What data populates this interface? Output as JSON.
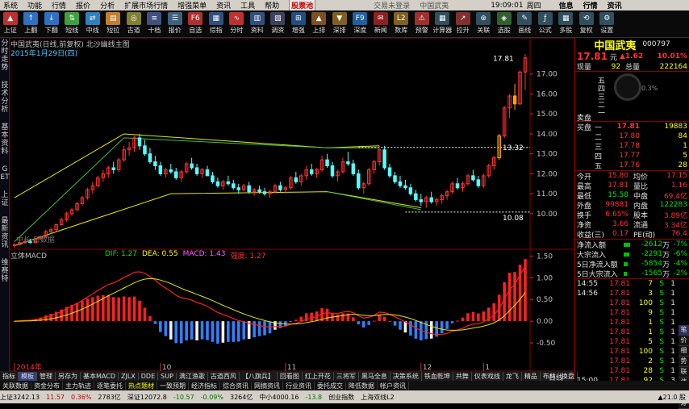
{
  "menu": {
    "items": [
      "系统",
      "功能",
      "行情",
      "报价",
      "分析",
      "扩展市场行情",
      "增强菜单",
      "资讯",
      "工具",
      "帮助"
    ],
    "promo": "股票池",
    "center_title": "交易未登录",
    "center_title2": "中国武夷",
    "clock": "19:09:01",
    "weekday": "周四",
    "right_items": [
      "信息",
      "行情",
      "资讯"
    ]
  },
  "toolbar": [
    {
      "label": "上证",
      "color": "#c03030",
      "glyph": "▲"
    },
    {
      "label": "上翻",
      "color": "#3070c0",
      "glyph": "↑"
    },
    {
      "label": "下翻",
      "color": "#3070c0",
      "glyph": "↓"
    },
    {
      "label": "短线",
      "color": "#40a040",
      "glyph": "⇅"
    },
    {
      "label": "中线",
      "color": "#3080c0",
      "glyph": "⇄"
    },
    {
      "label": "短拉",
      "color": "#c08030",
      "glyph": "▤"
    },
    {
      "label": "古道",
      "color": "#808030",
      "glyph": "◎"
    },
    {
      "label": "十档",
      "color": "#405080",
      "glyph": "≡"
    },
    {
      "label": "报价",
      "color": "#406080",
      "glyph": "☰"
    },
    {
      "label": "自选",
      "color": "#b03030",
      "glyph": "F6"
    },
    {
      "label": "综指",
      "color": "#305080",
      "glyph": "▦"
    },
    {
      "label": "分时",
      "color": "#c03030",
      "glyph": "∿"
    },
    {
      "label": "资料",
      "color": "#305080",
      "glyph": "▥"
    },
    {
      "label": "调资",
      "color": "#404060",
      "glyph": "▧"
    },
    {
      "label": "增强",
      "color": "#205080",
      "glyph": "⊞"
    },
    {
      "label": "上排",
      "color": "#805020",
      "glyph": "▲"
    },
    {
      "label": "深排",
      "color": "#806020",
      "glyph": "▼"
    },
    {
      "label": "深度",
      "color": "#2060a0",
      "glyph": "F9"
    },
    {
      "label": "新闻",
      "color": "#902020",
      "glyph": "✉"
    },
    {
      "label": "数库",
      "color": "#806020",
      "glyph": "L2"
    },
    {
      "label": "预警",
      "color": "#a03030",
      "glyph": "⚠"
    },
    {
      "label": "计算器",
      "color": "#305060",
      "glyph": "▦"
    },
    {
      "label": "拉升",
      "color": "#803030",
      "glyph": "↗"
    },
    {
      "label": "关联",
      "color": "#305060",
      "glyph": "⊛"
    },
    {
      "label": "选股",
      "color": "#306030",
      "glyph": "◈"
    },
    {
      "label": "画线",
      "color": "#305060",
      "glyph": "✎"
    },
    {
      "label": "公式",
      "color": "#305060",
      "glyph": "ƒ"
    },
    {
      "label": "多股",
      "color": "#305060",
      "glyph": "▦"
    },
    {
      "label": "复权",
      "color": "#305060",
      "glyph": "⟲"
    },
    {
      "label": "设置",
      "color": "#305060",
      "glyph": "⚙"
    }
  ],
  "sidebar": [
    "分时走势",
    "技术分析",
    "基本资料",
    "GET",
    "上证",
    "最新资讯",
    "维赛特"
  ],
  "chart": {
    "title": "中国武夷(日线,前复权) 北沙幽线主图",
    "date_label": "2015年1月29日(四)",
    "price_hi_label": "17.81",
    "ref_label_1": "13.32",
    "ref_label_2": "10.08",
    "watermark": "中长·日数据",
    "macd_title": "立体MACD",
    "macd_params": [
      "DIF: 1.27",
      "DEA: 0.55",
      "MACD: 1.43",
      "强度: 1.27"
    ],
    "x_labels": [
      "2014年",
      "10",
      "11",
      "12",
      "1"
    ],
    "period": "日线"
  },
  "chart_data": [
    {
      "type": "candlestick",
      "title": "中国武夷(日线,前复权) 北沙幽线主图",
      "ylim": [
        8.5,
        18.0
      ],
      "yticks": [
        10,
        11,
        12,
        13,
        14,
        15,
        16,
        17
      ],
      "ohlc": [
        [
          8.4,
          8.5,
          8.3,
          8.45
        ],
        [
          8.45,
          8.6,
          8.4,
          8.55
        ],
        [
          8.55,
          8.7,
          8.5,
          8.6
        ],
        [
          8.6,
          8.75,
          8.5,
          8.55
        ],
        [
          8.55,
          8.8,
          8.5,
          8.75
        ],
        [
          8.75,
          8.9,
          8.7,
          8.85
        ],
        [
          8.85,
          9.2,
          8.8,
          9.1
        ],
        [
          9.1,
          9.3,
          9.0,
          9.2
        ],
        [
          9.2,
          9.5,
          9.1,
          9.45
        ],
        [
          9.45,
          9.8,
          9.4,
          9.7
        ],
        [
          9.7,
          10.1,
          9.6,
          10.0
        ],
        [
          10.0,
          10.3,
          9.9,
          10.2
        ],
        [
          10.2,
          10.6,
          10.1,
          10.5
        ],
        [
          10.5,
          10.9,
          10.4,
          10.8
        ],
        [
          10.8,
          11.3,
          10.7,
          11.2
        ],
        [
          11.2,
          11.6,
          11.0,
          11.4
        ],
        [
          11.4,
          11.9,
          11.3,
          11.8
        ],
        [
          11.8,
          12.2,
          11.6,
          12.0
        ],
        [
          12.0,
          12.4,
          11.8,
          12.3
        ],
        [
          12.3,
          12.6,
          12.0,
          12.2
        ],
        [
          12.2,
          12.8,
          12.1,
          12.7
        ],
        [
          12.7,
          13.4,
          12.6,
          13.2
        ],
        [
          13.2,
          13.6,
          12.9,
          13.3
        ],
        [
          13.3,
          13.9,
          13.1,
          13.8
        ],
        [
          13.8,
          14.0,
          13.2,
          13.4
        ],
        [
          13.4,
          13.7,
          12.9,
          13.0
        ],
        [
          13.0,
          13.3,
          12.5,
          12.6
        ],
        [
          12.6,
          12.9,
          12.2,
          12.4
        ],
        [
          12.4,
          12.6,
          11.9,
          12.0
        ],
        [
          12.0,
          12.3,
          11.8,
          12.2
        ],
        [
          12.2,
          12.5,
          12.0,
          12.1
        ],
        [
          12.1,
          12.3,
          11.7,
          11.8
        ],
        [
          11.8,
          12.2,
          11.6,
          12.1
        ],
        [
          12.1,
          12.6,
          12.0,
          12.5
        ],
        [
          12.5,
          12.8,
          12.2,
          12.3
        ],
        [
          12.3,
          12.5,
          11.9,
          12.0
        ],
        [
          12.0,
          12.3,
          11.8,
          12.2
        ],
        [
          12.2,
          12.4,
          11.9,
          11.9
        ],
        [
          11.9,
          12.1,
          11.5,
          11.6
        ],
        [
          11.6,
          11.8,
          11.3,
          11.4
        ],
        [
          11.4,
          11.7,
          11.2,
          11.6
        ],
        [
          11.6,
          11.9,
          11.4,
          11.5
        ],
        [
          11.5,
          11.7,
          11.2,
          11.3
        ],
        [
          11.3,
          11.5,
          11.0,
          11.2
        ],
        [
          11.2,
          11.5,
          11.1,
          11.4
        ],
        [
          11.4,
          11.6,
          11.0,
          11.1
        ],
        [
          11.1,
          11.3,
          10.9,
          11.2
        ],
        [
          11.2,
          11.4,
          11.0,
          11.1
        ],
        [
          11.1,
          11.3,
          10.9,
          11.0
        ],
        [
          11.0,
          11.2,
          10.8,
          11.1
        ],
        [
          11.1,
          11.5,
          11.0,
          11.4
        ],
        [
          11.4,
          11.6,
          11.1,
          11.2
        ],
        [
          11.2,
          11.4,
          11.0,
          11.3
        ],
        [
          11.3,
          11.9,
          11.2,
          11.8
        ],
        [
          11.8,
          12.1,
          11.5,
          11.6
        ],
        [
          11.6,
          12.0,
          11.4,
          11.9
        ],
        [
          11.9,
          12.4,
          11.7,
          12.2
        ],
        [
          12.2,
          12.5,
          11.9,
          12.0
        ],
        [
          12.0,
          12.3,
          11.8,
          12.2
        ],
        [
          12.2,
          12.9,
          12.1,
          12.7
        ],
        [
          12.7,
          13.0,
          12.3,
          12.4
        ],
        [
          12.4,
          12.6,
          11.8,
          11.9
        ],
        [
          11.9,
          12.2,
          11.6,
          12.1
        ],
        [
          12.1,
          12.8,
          12.0,
          12.6
        ],
        [
          12.6,
          13.1,
          12.4,
          12.5
        ],
        [
          12.5,
          12.7,
          11.9,
          12.0
        ],
        [
          12.0,
          12.2,
          11.2,
          11.3
        ],
        [
          11.3,
          11.6,
          11.0,
          11.5
        ],
        [
          11.5,
          12.3,
          11.4,
          12.2
        ],
        [
          12.2,
          12.7,
          12.0,
          12.6
        ],
        [
          12.6,
          13.4,
          12.4,
          13.2
        ],
        [
          13.2,
          13.4,
          12.2,
          12.3
        ],
        [
          12.3,
          12.5,
          11.8,
          11.9
        ],
        [
          11.9,
          12.1,
          11.5,
          11.6
        ],
        [
          11.6,
          11.9,
          11.3,
          11.4
        ],
        [
          11.4,
          11.7,
          11.2,
          11.3
        ],
        [
          11.3,
          11.5,
          10.9,
          11.0
        ],
        [
          11.0,
          11.2,
          10.6,
          10.7
        ],
        [
          10.7,
          11.0,
          10.4,
          10.6
        ],
        [
          10.6,
          10.9,
          10.3,
          10.8
        ],
        [
          10.8,
          11.1,
          10.5,
          10.6
        ],
        [
          10.6,
          10.8,
          10.4,
          10.7
        ],
        [
          10.7,
          11.0,
          10.5,
          10.9
        ],
        [
          10.9,
          11.2,
          10.7,
          11.1
        ],
        [
          11.1,
          11.6,
          11.0,
          11.5
        ],
        [
          11.5,
          11.8,
          11.2,
          11.3
        ],
        [
          11.3,
          11.6,
          11.1,
          11.5
        ],
        [
          11.5,
          12.0,
          11.4,
          11.9
        ],
        [
          11.9,
          12.2,
          11.6,
          11.7
        ],
        [
          11.7,
          11.9,
          11.3,
          11.4
        ],
        [
          11.4,
          12.0,
          11.3,
          11.9
        ],
        [
          11.9,
          12.5,
          11.8,
          12.4
        ],
        [
          12.4,
          12.9,
          12.2,
          12.8
        ],
        [
          12.8,
          14.0,
          12.7,
          13.9
        ],
        [
          13.9,
          15.4,
          13.8,
          15.3
        ],
        [
          15.3,
          16.0,
          14.8,
          15.9
        ],
        [
          15.9,
          16.5,
          15.2,
          15.5
        ],
        [
          15.5,
          17.17,
          15.45,
          17.1
        ],
        [
          17.1,
          18.0,
          16.2,
          17.81
        ]
      ]
    },
    {
      "type": "bar",
      "title": "立体MACD",
      "series": [
        {
          "name": "DIF",
          "value": 1.27
        },
        {
          "name": "DEA",
          "value": 0.55
        },
        {
          "name": "MACD",
          "value": 1.43
        }
      ],
      "ylim": [
        -1.0,
        1.6
      ]
    }
  ],
  "quote": {
    "name": "中国武夷",
    "code": "000797",
    "price": "17.81",
    "unit": "元",
    "change": "▲1.62",
    "pct": "10.01%",
    "vol_now_label": "现量",
    "vol_now": "92",
    "vol_total_label": "总量",
    "vol_total": "222164",
    "ratio_label": "0.3%",
    "sell_label": "卖盘",
    "buy_label": "买盘",
    "levels": [
      "五",
      "四",
      "三",
      "二",
      "一"
    ],
    "bids": [
      {
        "l": "一",
        "p": "17.81",
        "v": "19883"
      },
      {
        "l": "二",
        "p": "17.80",
        "v": "84"
      },
      {
        "l": "三",
        "p": "17.78",
        "v": "1"
      },
      {
        "l": "四",
        "p": "17.77",
        "v": "5"
      },
      {
        "l": "五",
        "p": "17.76",
        "v": "28"
      }
    ],
    "stats": [
      [
        "今开",
        "15.80",
        "均价",
        "17.15"
      ],
      [
        "最高",
        "17.81",
        "量比",
        "1.16"
      ],
      [
        "最低",
        "15.58",
        "中盘",
        "69.4亿"
      ],
      [
        "外盘",
        "99881",
        "内盘",
        "122283"
      ],
      [
        "换手",
        "6.65%",
        "股本",
        "3.89亿"
      ],
      [
        "净资",
        "3.66",
        "流通",
        "3.34亿"
      ],
      [
        "收益(三)",
        "0.17",
        "PE(动)",
        "76.4"
      ]
    ],
    "flows": [
      [
        "净流入额",
        "-2612",
        "万",
        "-7%"
      ],
      [
        "大宗流入",
        "-2291",
        "万",
        "-6%"
      ],
      [
        "5日净流入额",
        "-5854",
        "万",
        "-4%"
      ],
      [
        "5日大宗流入",
        "-1565",
        "万",
        "-2%"
      ]
    ],
    "ticks": [
      [
        "14:55",
        "17.81",
        "7",
        "S",
        "1"
      ],
      [
        "14:56",
        "17.81",
        "3",
        "S",
        "1"
      ],
      [
        "",
        "17.81",
        "100",
        "S",
        "1"
      ],
      [
        "",
        "17.81",
        "9",
        "S",
        "1"
      ],
      [
        "",
        "17.81",
        "1",
        "S",
        "1"
      ],
      [
        "",
        "17.81",
        "1",
        "S",
        "1"
      ],
      [
        "",
        "17.81",
        "5",
        "S",
        "1"
      ],
      [
        "",
        "17.81",
        "100",
        "S",
        "1"
      ],
      [
        "",
        "17.81",
        "2",
        "S",
        "1"
      ],
      [
        "",
        "17.81",
        "28",
        "S",
        "1"
      ],
      [
        "15:00",
        "17.81",
        "92",
        "S",
        "3"
      ]
    ],
    "side_tabs": [
      "笔",
      "价",
      "细",
      "势",
      "联",
      "值",
      "主",
      "筹"
    ]
  },
  "bottom_tabs": [
    "指标",
    "模板",
    "管理",
    "另存为",
    "基本MACD",
    "ZJLX",
    "DDE",
    "SUP",
    "满江渔歌",
    "古道西风",
    "【八旗兵】",
    "回看图",
    "红上开花",
    "三将军",
    "黑马全息",
    "决策系统",
    "铁血乾坤",
    "共舞",
    "仪表戏线",
    "龙飞",
    "精品",
    "布林",
    "换盘"
  ],
  "bottom_links": [
    "关联数据",
    "资金分布",
    "主力轨迹",
    "逐笔委托",
    "热点题材",
    "一致预期",
    "经济指标",
    "综合资讯",
    "网摘资讯",
    "行业资讯",
    "委托成交",
    "降低数据",
    "帐户资讯"
  ],
  "status": {
    "items": [
      "上证3242.13",
      "11.57",
      "0.36%",
      "2783亿",
      "深证12072.8",
      "-10.57",
      "-0.09%",
      "3264亿",
      "中小4000.16",
      "-13.8",
      "创业指数",
      "上海双线L2"
    ],
    "right": "▲21.0 股"
  }
}
